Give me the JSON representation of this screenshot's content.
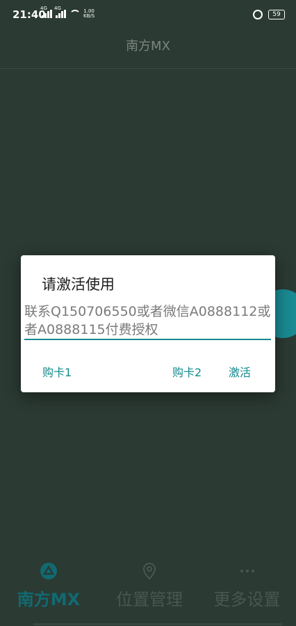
{
  "status_bar": {
    "time": "21:40",
    "network_1": "4G",
    "network_2": "4G",
    "speed_value": "1.00",
    "speed_unit": "KB/S",
    "battery": "59"
  },
  "app_bar": {
    "title": "南方MX"
  },
  "dialog": {
    "title": "请激活使用",
    "message": "联系Q150706550或者微信A0888112或者A0888115付费授权",
    "buttons": {
      "buy_card_1": "购卡1",
      "buy_card_2": "购卡2",
      "activate": "激活"
    },
    "accent_color": "#138a8e"
  },
  "bottom_nav": {
    "items": [
      {
        "label": "南方MX",
        "icon": "app-logo-icon",
        "active": true
      },
      {
        "label": "位置管理",
        "icon": "location-pin-icon",
        "active": false
      },
      {
        "label": "更多设置",
        "icon": "more-dots-icon",
        "active": false
      }
    ]
  }
}
